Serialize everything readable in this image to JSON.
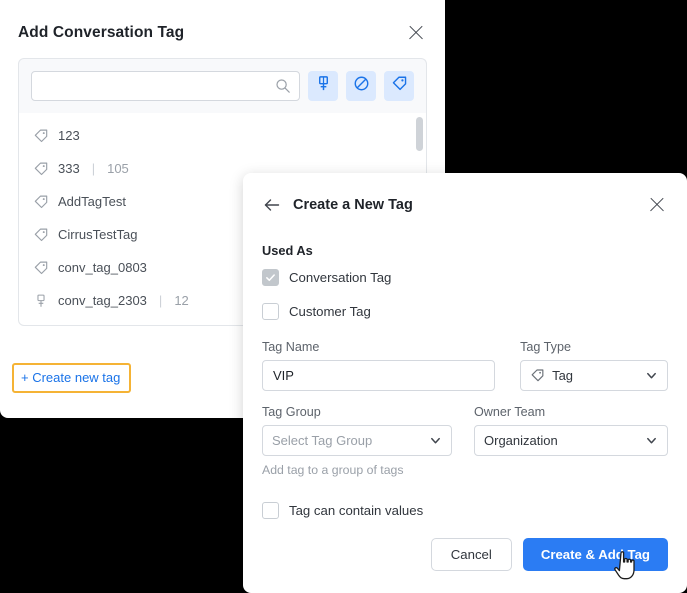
{
  "add_conversation_tag_panel": {
    "title": "Add Conversation Tag",
    "close_icon": "close-icon",
    "search": {
      "value": "",
      "placeholder": "",
      "icon": "search-icon"
    },
    "filter_buttons": [
      {
        "name": "medal-filter",
        "icon": "medal-icon"
      },
      {
        "name": "no-tag-filter",
        "icon": "ban-icon"
      },
      {
        "name": "tag-filter",
        "icon": "tag-icon"
      }
    ],
    "tag_items": [
      {
        "icon": "tag-icon",
        "label": "123",
        "count": ""
      },
      {
        "icon": "tag-icon",
        "label": "333",
        "count": "105"
      },
      {
        "icon": "tag-icon",
        "label": "AddTagTest",
        "count": ""
      },
      {
        "icon": "tag-icon",
        "label": "CirrusTestTag",
        "count": ""
      },
      {
        "icon": "tag-icon",
        "label": "conv_tag_0803",
        "count": ""
      },
      {
        "icon": "medal-icon",
        "label": "conv_tag_2303",
        "count": "12"
      }
    ],
    "create_new_tag_label": "+ Create new tag",
    "highlight_color": "#f5b335",
    "link_color": "#1a73e8"
  },
  "create_tag_panel": {
    "title": "Create a New Tag",
    "back_icon": "arrow-left-icon",
    "close_icon": "close-icon",
    "used_as_label": "Used As",
    "checkboxes": [
      {
        "label": "Conversation Tag",
        "checked": true,
        "disabled": true
      },
      {
        "label": "Customer Tag",
        "checked": false,
        "disabled": false
      }
    ],
    "tag_name": {
      "label": "Tag Name",
      "value": "VIP",
      "placeholder": ""
    },
    "tag_type": {
      "label": "Tag Type",
      "value": "Tag",
      "icon": "tag-icon"
    },
    "tag_group": {
      "label": "Tag Group",
      "value": "Select Tag Group",
      "is_placeholder": true,
      "helper": "Add tag to a group of tags"
    },
    "owner_team": {
      "label": "Owner Team",
      "value": "Organization"
    },
    "tag_can_contain_values": {
      "label": "Tag can contain values",
      "checked": false
    },
    "cancel_label": "Cancel",
    "primary_label": "Create & Add Tag",
    "primary_color": "#2b7cf3"
  }
}
